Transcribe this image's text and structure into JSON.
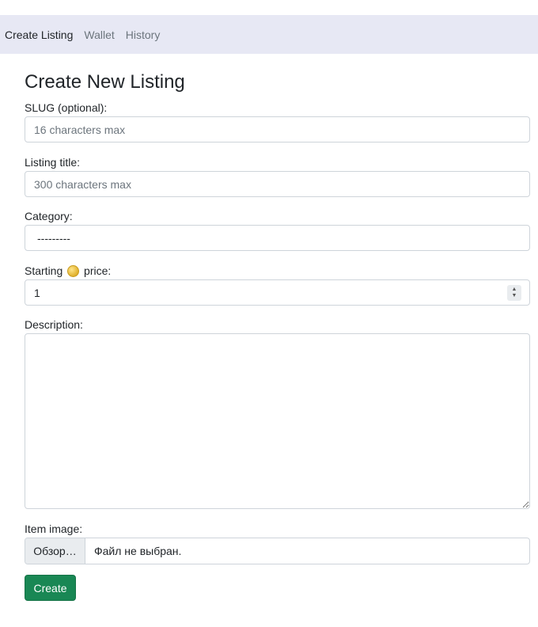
{
  "nav": {
    "items": [
      {
        "label": "Create Listing",
        "active": true
      },
      {
        "label": "Wallet",
        "active": false
      },
      {
        "label": "History",
        "active": false
      }
    ]
  },
  "page": {
    "title": "Create New Listing"
  },
  "form": {
    "slug": {
      "label": "SLUG (optional):",
      "placeholder": "16 characters max",
      "value": ""
    },
    "title": {
      "label": "Listing title:",
      "placeholder": "300 characters max",
      "value": ""
    },
    "category": {
      "label": "Category:",
      "selected": "---------"
    },
    "price": {
      "label_prefix": "Starting",
      "label_suffix": "price:",
      "icon": "coin-icon",
      "value": "1"
    },
    "description": {
      "label": "Description:",
      "value": ""
    },
    "image": {
      "label": "Item image:",
      "browse_label": "Обзор…",
      "filename": "Файл не выбран."
    },
    "submit_label": "Create"
  },
  "colors": {
    "nav_bg": "#e7e8f4",
    "submit_bg": "#198754",
    "border": "#ced4da"
  }
}
